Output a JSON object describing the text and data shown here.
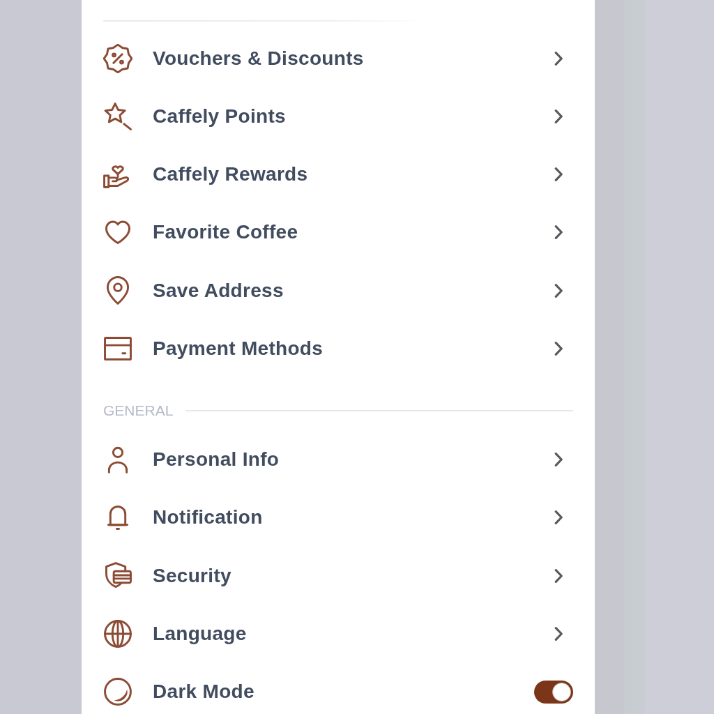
{
  "sections": [
    {
      "items": [
        {
          "kind": "link",
          "label": "Vouchers & Discounts"
        },
        {
          "kind": "link",
          "label": "Caffely Points"
        },
        {
          "kind": "link",
          "label": "Caffely Rewards"
        },
        {
          "kind": "link",
          "label": "Favorite Coffee"
        },
        {
          "kind": "link",
          "label": "Save Address"
        },
        {
          "kind": "link",
          "label": "Payment Methods"
        }
      ]
    },
    {
      "title": "GENERAL",
      "items": [
        {
          "kind": "link",
          "label": "Personal Info"
        },
        {
          "kind": "link",
          "label": "Notification"
        },
        {
          "kind": "link",
          "label": "Security"
        },
        {
          "kind": "link",
          "label": "Language"
        },
        {
          "kind": "toggle",
          "label": "Dark Mode",
          "on": true
        }
      ]
    }
  ]
}
